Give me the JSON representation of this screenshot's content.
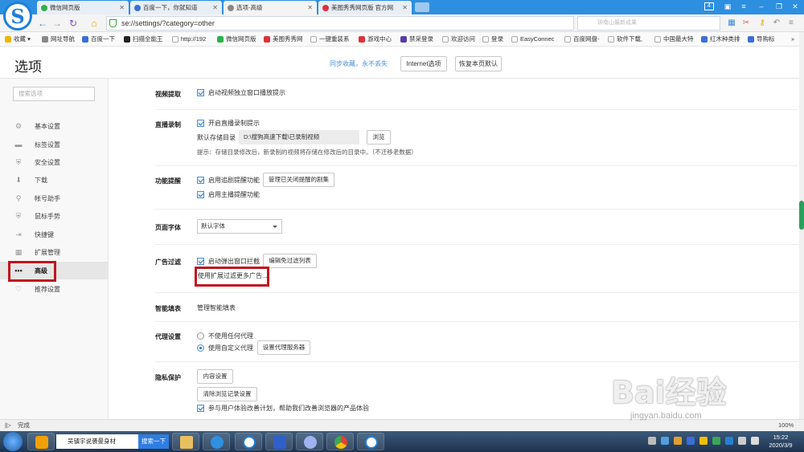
{
  "tabs": [
    {
      "label": "微信网页版",
      "color": "#2bb24c"
    },
    {
      "label": "百度一下，你就知道",
      "color": "#3a6fd8"
    },
    {
      "label": "选项-高级",
      "color": "#888888"
    },
    {
      "label": "美图秀秀网页版 官方网",
      "color": "#e0303a"
    }
  ],
  "window_controls": {
    "tab_count": "4",
    "minimize": "–",
    "restore": "❐",
    "close": "✕"
  },
  "address": {
    "url": "se://settings/?category=other",
    "search_placeholder": "钟南山最新成果"
  },
  "nav_icons": {
    "back": "←",
    "forward": "→",
    "refresh": "↻",
    "home": "⌂"
  },
  "bookmarks": [
    {
      "label": "收藏 ▾",
      "color": "#f0b400"
    },
    {
      "label": "网址导航",
      "color": "#888888"
    },
    {
      "label": "百度一下",
      "color": "#3a6fd8"
    },
    {
      "label": "扫描全能王",
      "color": "#222222"
    },
    {
      "label": "http://192",
      "color": "#aaaaaa"
    },
    {
      "label": "微信网页版",
      "color": "#2bb24c"
    },
    {
      "label": "美图秀秀网",
      "color": "#e0303a"
    },
    {
      "label": "一键重装系",
      "color": "#aaaaaa"
    },
    {
      "label": "游戏中心",
      "color": "#e0303a"
    },
    {
      "label": "禁采登录",
      "color": "#5b3aa8"
    },
    {
      "label": "欢迎访问",
      "color": "#aaaaaa"
    },
    {
      "label": "登录",
      "color": "#aaaaaa"
    },
    {
      "label": "EasyConnec",
      "color": "#aaaaaa"
    },
    {
      "label": "百度网盘-",
      "color": "#aaaaaa"
    },
    {
      "label": "软件下载,",
      "color": "#aaaaaa"
    },
    {
      "label": "中国最大特",
      "color": "#aaaaaa"
    },
    {
      "label": "红木种类排",
      "color": "#3a6fd8"
    },
    {
      "label": "导购标",
      "color": "#3a6fd8"
    }
  ],
  "bookmarks_more": "»",
  "header": {
    "title": "选项",
    "sync_link": "同步收藏，永不丢失",
    "internet_options": "Internet选项",
    "restore_defaults": "恢复本页默认"
  },
  "sidebar": {
    "search_placeholder": "搜索选项",
    "items": [
      {
        "label": "基本设置",
        "icon": "⚙"
      },
      {
        "label": "标签设置",
        "icon": "▬"
      },
      {
        "label": "安全设置",
        "icon": "⛨"
      },
      {
        "label": "下载",
        "icon": "⬇"
      },
      {
        "label": "帐号助手",
        "icon": "⚲"
      },
      {
        "label": "鼠标手势",
        "icon": "⛨"
      },
      {
        "label": "快捷键",
        "icon": "⇥"
      },
      {
        "label": "扩展管理",
        "icon": "▦"
      },
      {
        "label": "高级",
        "icon": "•••"
      },
      {
        "label": "推荐设置",
        "icon": "♡"
      }
    ],
    "active_index": 8
  },
  "sections": {
    "video": {
      "label": "视频提取",
      "option": "启动视频独立窗口播放提示"
    },
    "live": {
      "label": "直播录制",
      "option": "开启直播录制提示",
      "dir_label": "默认存储目录",
      "dir_value": "D:\\搜狗高速下载\\已录制视频",
      "browse": "浏览",
      "hint": "提示：存储目录修改后，新录制的视频将存储在修改后的目录中。（不迁移老数据）"
    },
    "reminder": {
      "label": "功能提醒",
      "option1": "启用追剧提醒功能",
      "manage": "管理已关闭提醒的剧集",
      "option2": "启用主播提醒功能"
    },
    "font": {
      "label": "页面字体",
      "value": "默认字体"
    },
    "adblock": {
      "label": "广告过滤",
      "option": "启动弹出窗口拦截",
      "edit_list": "编辑免过滤列表",
      "more": "使用扩展过滤更多广告..."
    },
    "autofill": {
      "label": "智能填表",
      "link": "管理智能填表"
    },
    "proxy": {
      "label": "代理设置",
      "none": "不使用任何代理",
      "custom": "使用自定义代理",
      "set_server": "设置代理服务器"
    },
    "privacy": {
      "label": "隐私保护",
      "content": "内容设置",
      "clear": "清除浏览记录设置",
      "experience": "参与用户体验改善计划，帮助我们改善浏览器的产品体验"
    }
  },
  "status": {
    "text": "完成",
    "zoom": "100%"
  },
  "watermark": {
    "main": "Bai经验",
    "sub": "jingyan.baidu.com"
  },
  "taskbar": {
    "search_text": "吴镇宇说袭曼身材",
    "search_button": "搜索一下",
    "time": "15:22",
    "date": "2020/3/9"
  }
}
